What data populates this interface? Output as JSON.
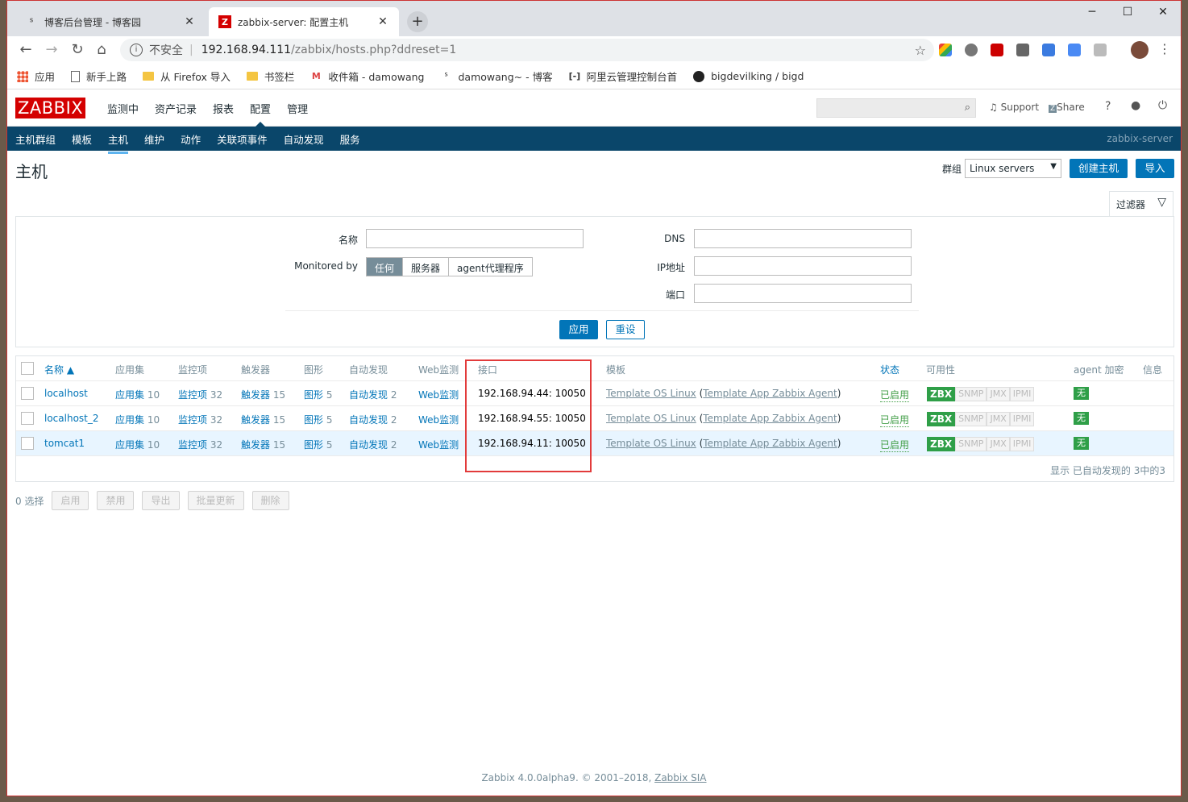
{
  "browser": {
    "tabs": [
      {
        "title": "博客后台管理 - 博客园",
        "active": false
      },
      {
        "title": "zabbix-server: 配置主机",
        "active": true
      }
    ],
    "new_tab": "+",
    "controls": {
      "minimize": "─",
      "maximize": "☐",
      "close": "✕"
    },
    "omnibox": {
      "security": "不安全",
      "host": "192.168.94.111",
      "path": "/zabbix/hosts.php?ddreset=1"
    },
    "bookmarks": [
      {
        "icon": "apps-icon",
        "label": "应用"
      },
      {
        "icon": "doc-icon",
        "label": "新手上路"
      },
      {
        "icon": "folder-icon",
        "label": "从 Firefox 导入"
      },
      {
        "icon": "folder-icon",
        "label": "书签栏"
      },
      {
        "icon": "gmail-icon",
        "label": "收件箱 - damowang"
      },
      {
        "icon": "cnblogs-icon",
        "label": "damowang~ - 博客"
      },
      {
        "icon": "aliyun-icon",
        "label": "阿里云管理控制台首"
      },
      {
        "icon": "github-icon",
        "label": "bigdevilking / bigd"
      }
    ]
  },
  "zabbix": {
    "logo": "ZABBIX",
    "top_menu": [
      "监测中",
      "资产记录",
      "报表",
      "配置",
      "管理"
    ],
    "top_selected": "配置",
    "support": "Support",
    "share": "Share",
    "help": "?",
    "sub_menu": [
      "主机群组",
      "模板",
      "主机",
      "维护",
      "动作",
      "关联项事件",
      "自动发现",
      "服务"
    ],
    "sub_selected": "主机",
    "server_name": "zabbix-server"
  },
  "page": {
    "title": "主机",
    "group_label": "群组",
    "group_value": "Linux servers",
    "create_button": "创建主机",
    "import_button": "导入"
  },
  "filter": {
    "tab_label": "过滤器",
    "name_label": "名称",
    "name_value": "",
    "monitored_label": "Monitored by",
    "monitored_options": [
      "任何",
      "服务器",
      "agent代理程序"
    ],
    "dns_label": "DNS",
    "dns_value": "",
    "ip_label": "IP地址",
    "ip_value": "",
    "port_label": "端口",
    "port_value": "",
    "apply": "应用",
    "reset": "重设"
  },
  "table": {
    "headers": {
      "name": "名称 ▲",
      "apps": "应用集",
      "items": "监控项",
      "triggers": "触发器",
      "graphs": "图形",
      "discovery": "自动发现",
      "web": "Web监测",
      "interface": "接口",
      "templates": "模板",
      "status": "状态",
      "availability": "可用性",
      "encryption": "agent 加密",
      "info": "信息"
    },
    "rows": [
      {
        "name": "localhost",
        "apps": "应用集",
        "apps_n": "10",
        "items": "监控项",
        "items_n": "32",
        "triggers": "触发器",
        "triggers_n": "15",
        "graphs": "图形",
        "graphs_n": "5",
        "discovery": "自动发现",
        "discovery_n": "2",
        "web": "Web监测",
        "interface": "192.168.94.44: 10050",
        "tpl1": "Template OS Linux",
        "tpl2": "(",
        "tpl3": "Template App Zabbix Agent",
        "tpl4": ")",
        "status": "已启用",
        "avail": [
          "ZBX",
          "SNMP",
          "JMX",
          "IPMI"
        ],
        "enc": "无"
      },
      {
        "name": "localhost_2",
        "apps": "应用集",
        "apps_n": "10",
        "items": "监控项",
        "items_n": "32",
        "triggers": "触发器",
        "triggers_n": "15",
        "graphs": "图形",
        "graphs_n": "5",
        "discovery": "自动发现",
        "discovery_n": "2",
        "web": "Web监测",
        "interface": "192.168.94.55: 10050",
        "tpl1": "Template OS Linux",
        "tpl2": "(",
        "tpl3": "Template App Zabbix Agent",
        "tpl4": ")",
        "status": "已启用",
        "avail": [
          "ZBX",
          "SNMP",
          "JMX",
          "IPMI"
        ],
        "enc": "无"
      },
      {
        "name": "tomcat1",
        "apps": "应用集",
        "apps_n": "10",
        "items": "监控项",
        "items_n": "32",
        "triggers": "触发器",
        "triggers_n": "15",
        "graphs": "图形",
        "graphs_n": "5",
        "discovery": "自动发现",
        "discovery_n": "2",
        "web": "Web监测",
        "interface": "192.168.94.11: 10050",
        "tpl1": "Template OS Linux",
        "tpl2": "(",
        "tpl3": "Template App Zabbix Agent",
        "tpl4": ")",
        "status": "已启用",
        "avail": [
          "ZBX",
          "SNMP",
          "JMX",
          "IPMI"
        ],
        "enc": "无"
      }
    ],
    "summary": "显示 已自动发现的 3中的3"
  },
  "actions": {
    "selected": "0 选择",
    "buttons": [
      "启用",
      "禁用",
      "导出",
      "批量更新",
      "删除"
    ]
  },
  "footer": {
    "text": "Zabbix 4.0.0alpha9. © 2001–2018, ",
    "link": "Zabbix SIA"
  },
  "colors": {
    "zabbix_red": "#d40000",
    "nav_blue": "#0a466a",
    "link_blue": "#0275b8",
    "ok_green": "#429e47",
    "highlight_red": "#e23b3b"
  }
}
